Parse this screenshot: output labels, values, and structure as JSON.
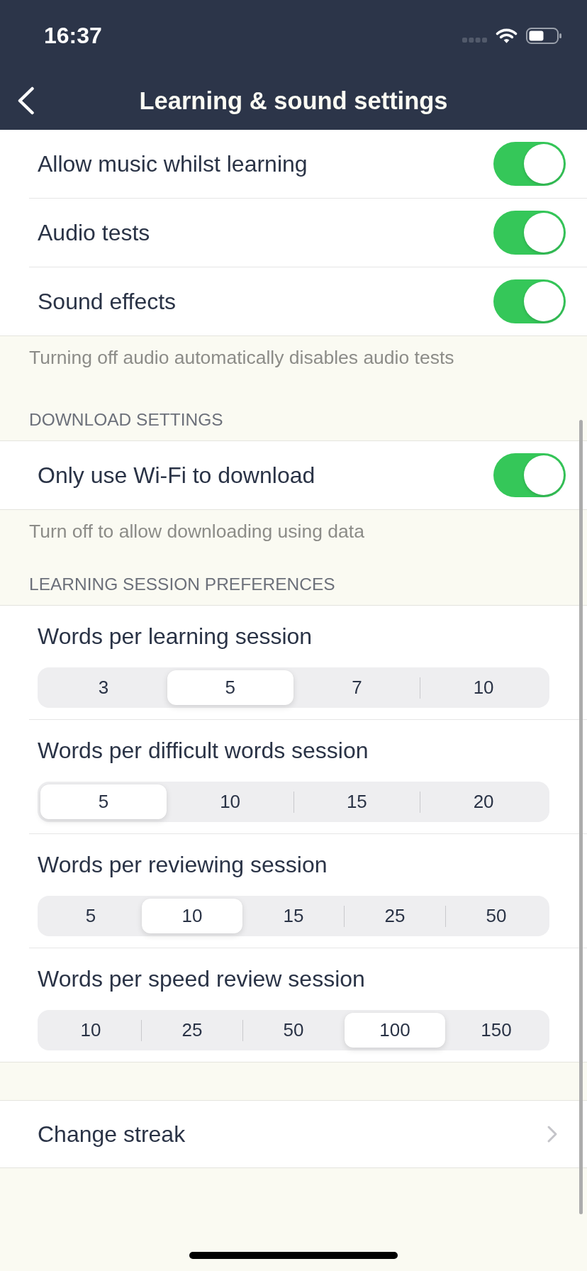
{
  "status_bar": {
    "time": "16:37"
  },
  "nav_bar": {
    "title": "Learning & sound settings"
  },
  "sections": [
    {
      "rows": [
        {
          "kind": "toggle",
          "label": "Allow music whilst learning",
          "on": true
        },
        {
          "kind": "toggle",
          "label": "Audio tests",
          "on": true
        },
        {
          "kind": "toggle",
          "label": "Sound effects",
          "on": true
        }
      ],
      "footer": "Turning off audio automatically disables audio tests"
    },
    {
      "header": "DOWNLOAD SETTINGS",
      "rows": [
        {
          "kind": "toggle",
          "label": "Only use Wi-Fi to download",
          "on": true
        }
      ],
      "footer": "Turn off to allow downloading using data"
    },
    {
      "header": "LEARNING SESSION PREFERENCES",
      "rows": [
        {
          "kind": "segmented",
          "label": "Words per learning session",
          "options": [
            {
              "label": "3",
              "selected": false
            },
            {
              "label": "5",
              "selected": true
            },
            {
              "label": "7",
              "selected": false
            },
            {
              "label": "10",
              "selected": false
            }
          ]
        },
        {
          "kind": "segmented",
          "label": "Words per difficult words session",
          "options": [
            {
              "label": "5",
              "selected": true
            },
            {
              "label": "10",
              "selected": false
            },
            {
              "label": "15",
              "selected": false
            },
            {
              "label": "20",
              "selected": false
            }
          ]
        },
        {
          "kind": "segmented",
          "label": "Words per reviewing session",
          "options": [
            {
              "label": "5",
              "selected": false
            },
            {
              "label": "10",
              "selected": true
            },
            {
              "label": "15",
              "selected": false
            },
            {
              "label": "25",
              "selected": false
            },
            {
              "label": "50",
              "selected": false
            }
          ]
        },
        {
          "kind": "segmented",
          "label": "Words per speed review session",
          "options": [
            {
              "label": "10",
              "selected": false
            },
            {
              "label": "25",
              "selected": false
            },
            {
              "label": "50",
              "selected": false
            },
            {
              "label": "100",
              "selected": true
            },
            {
              "label": "150",
              "selected": false
            }
          ]
        }
      ]
    },
    {
      "rows": [
        {
          "kind": "link",
          "label": "Change streak"
        }
      ]
    }
  ]
}
